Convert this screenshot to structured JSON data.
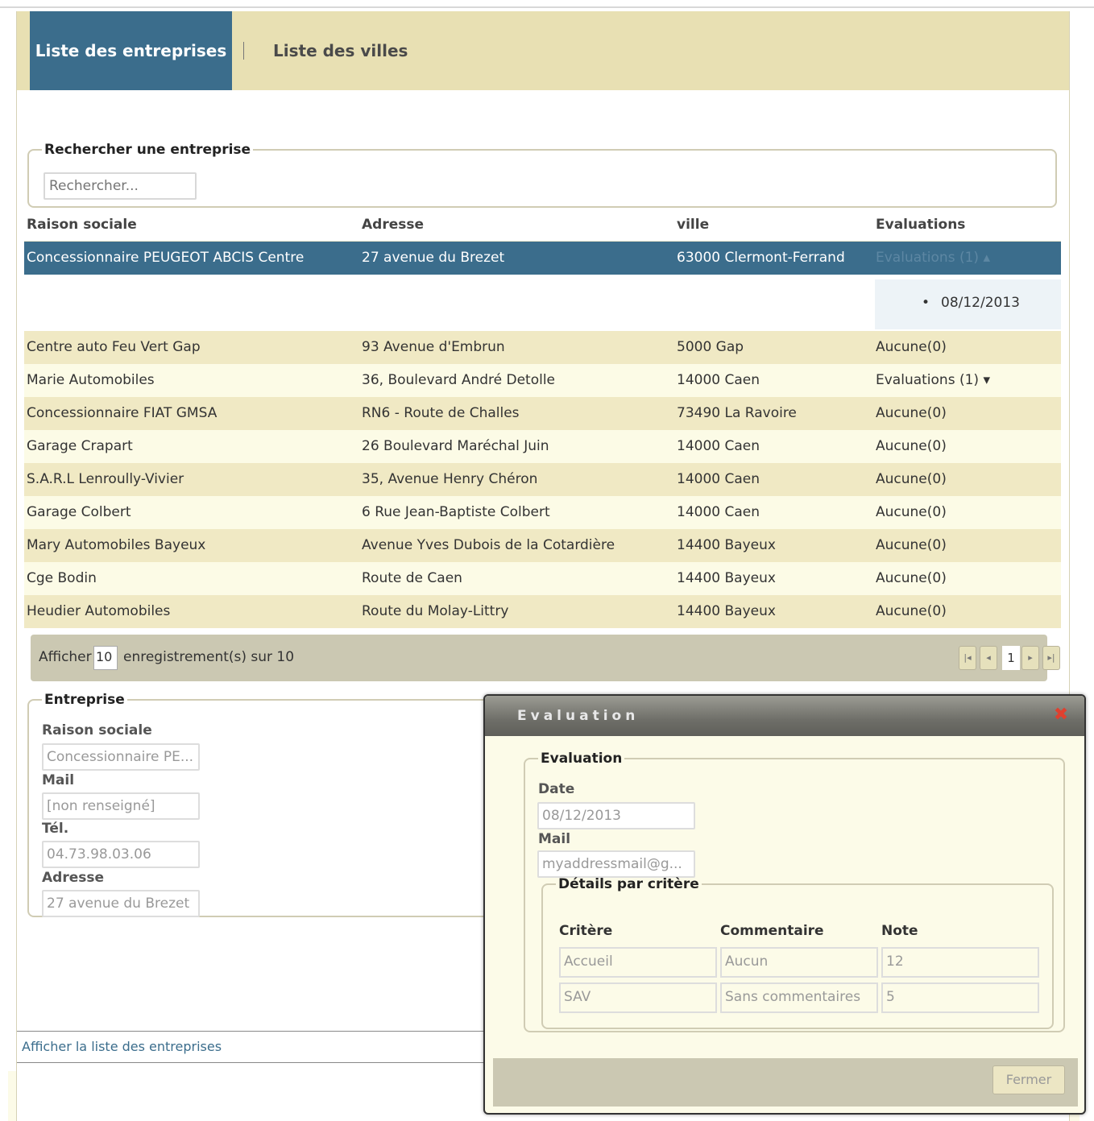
{
  "tabs": {
    "active": "Liste des entreprises",
    "second": "Liste des villes"
  },
  "search": {
    "legend": "Rechercher une entreprise",
    "placeholder": "Rechercher..."
  },
  "table": {
    "headers": [
      "Raison sociale",
      "Adresse",
      "ville",
      "Evaluations"
    ],
    "rows": [
      [
        "Concessionnaire PEUGEOT ABCIS Centre",
        "27 avenue du Brezet",
        "63000 Clermont-Ferrand",
        "Evaluations (1) ▴"
      ],
      [
        "Centre auto Feu Vert Gap",
        "93 Avenue d'Embrun",
        "5000 Gap",
        "Aucune(0)"
      ],
      [
        "Marie Automobiles",
        "36, Boulevard André Detolle",
        "14000 Caen",
        "Evaluations (1) ▾"
      ],
      [
        "Concessionnaire FIAT GMSA",
        "RN6 - Route de Challes",
        "73490 La Ravoire",
        "Aucune(0)"
      ],
      [
        "Garage Crapart",
        "26 Boulevard Maréchal Juin",
        "14000 Caen",
        "Aucune(0)"
      ],
      [
        "S.A.R.L Lenroully-Vivier",
        "35, Avenue Henry Chéron",
        "14000 Caen",
        "Aucune(0)"
      ],
      [
        "Garage Colbert",
        "6 Rue Jean-Baptiste Colbert",
        "14000 Caen",
        "Aucune(0)"
      ],
      [
        "Mary Automobiles Bayeux",
        "Avenue Yves Dubois de la Cotardière",
        "14400 Bayeux",
        "Aucune(0)"
      ],
      [
        "Cge Bodin",
        "Route de Caen",
        "14400 Bayeux",
        "Aucune(0)"
      ],
      [
        "Heudier Automobiles",
        "Route du Molay-Littry",
        "14400 Bayeux",
        "Aucune(0)"
      ]
    ],
    "expanded_date": "08/12/2013",
    "bullet": "•"
  },
  "pager": {
    "show_label": "Afficher",
    "length": "10",
    "records_label": "enregistrement(s) sur 10",
    "current_page": "1",
    "first": "|◂",
    "prev": "◂",
    "next": "▸",
    "last": "▸|"
  },
  "entreprise": {
    "legend": "Entreprise",
    "raison_label": "Raison sociale",
    "raison_value": "Concessionnaire PE...",
    "mail_label": "Mail",
    "mail_value": "[non renseigné]",
    "tel_label": "Tél.",
    "tel_value": "04.73.98.03.06",
    "adresse_label": "Adresse",
    "adresse_value": "27 avenue du Brezet"
  },
  "footer_link": "Afficher la liste des entreprises",
  "dialog": {
    "title": "Evaluation",
    "close": "✖",
    "legend": "Evaluation",
    "date_label": "Date",
    "date_value": "08/12/2013",
    "mail_label": "Mail",
    "mail_value": "myaddressmail@g...",
    "details_legend": "Détails par critère",
    "col_critere": "Critère",
    "col_commentaire": "Commentaire",
    "col_note": "Note",
    "criteria": [
      {
        "critere": "Accueil",
        "commentaire": "Aucun",
        "note": "12"
      },
      {
        "critere": "SAV",
        "commentaire": "Sans commentaires",
        "note": "5"
      }
    ],
    "close_button": "Fermer"
  },
  "colors": {
    "accent": "#3b6d8c",
    "tab_bar": "#e8e0b3",
    "row_odd": "#f0e9c4",
    "row_even": "#fcfbe6"
  }
}
